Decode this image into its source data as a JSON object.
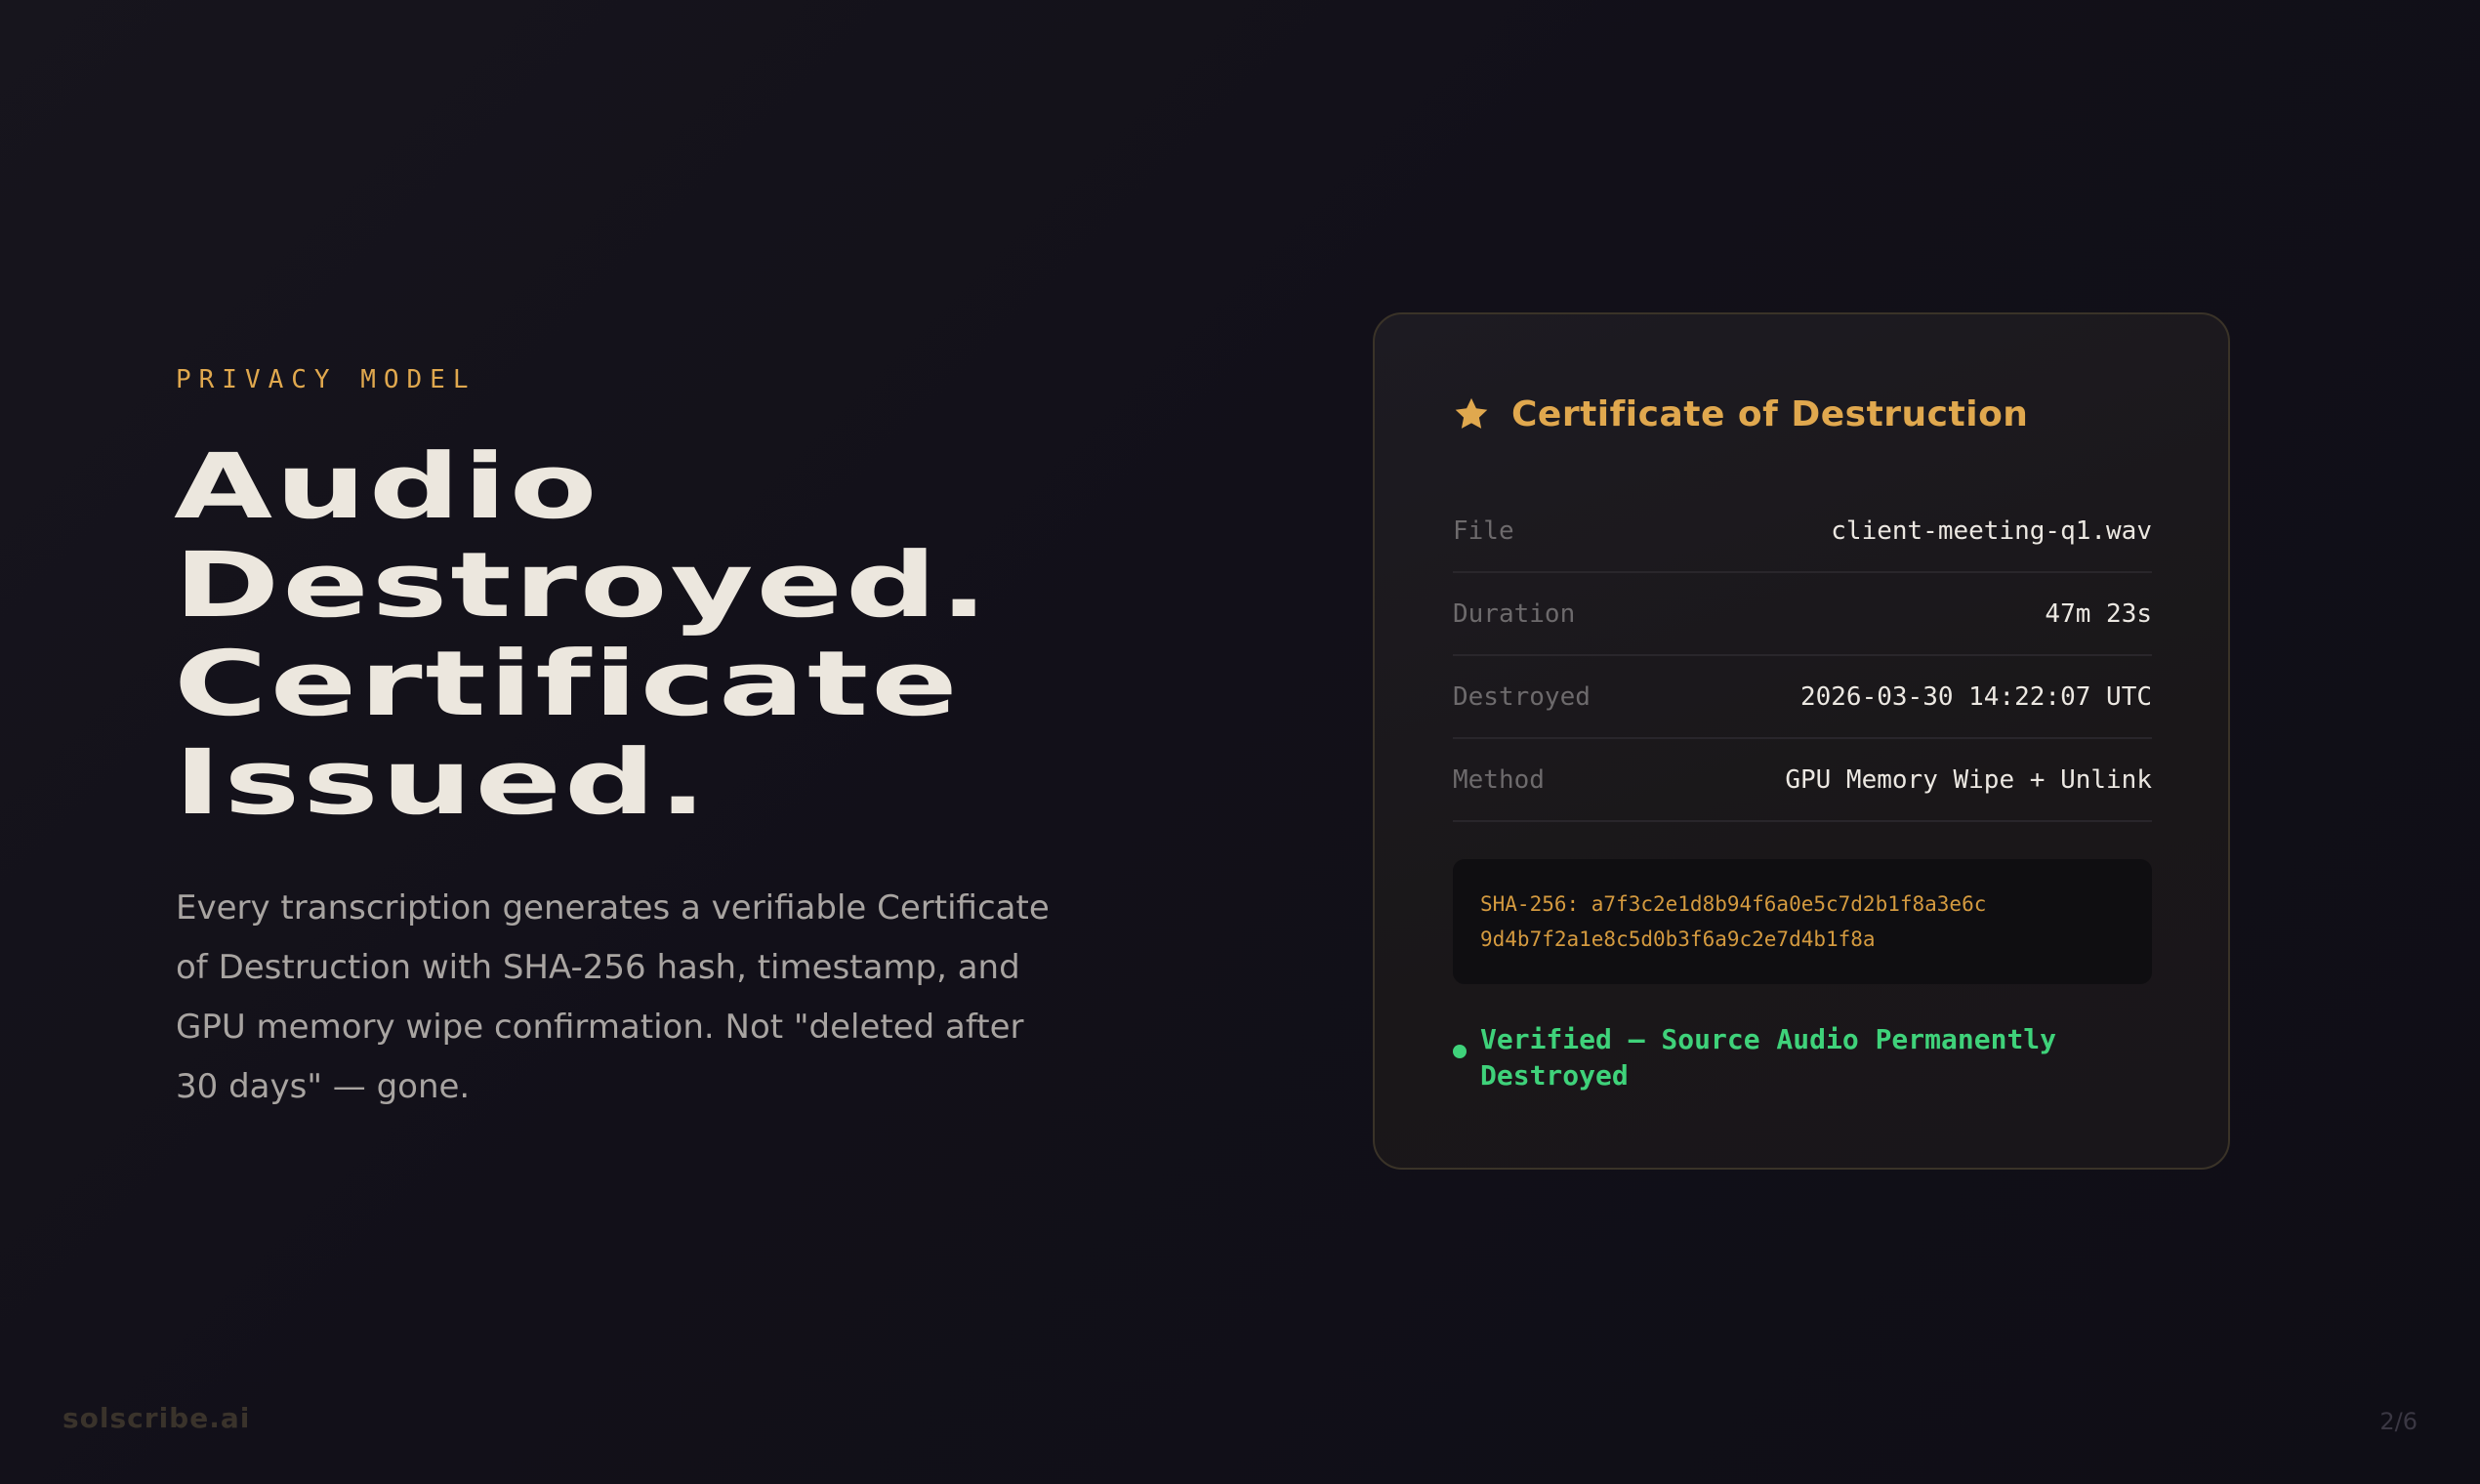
{
  "eyebrow": "PRIVACY MODEL",
  "headline": {
    "line1": "Audio",
    "line2": "Destroyed.",
    "line3": "Certificate",
    "line4": "Issued."
  },
  "body": "Every transcription generates a verifiable Certificate of Destruction with SHA-256 hash, timestamp, and GPU memory wipe confirmation. Not \"deleted after 30 days\" — gone.",
  "certificate": {
    "icon": "star-icon",
    "title": "Certificate of Destruction",
    "rows": [
      {
        "label": "File",
        "value": "client-meeting-q1.wav"
      },
      {
        "label": "Duration",
        "value": "47m 23s"
      },
      {
        "label": "Destroyed",
        "value": "2026-03-30 14:22:07 UTC"
      },
      {
        "label": "Method",
        "value": "GPU Memory Wipe + Unlink"
      }
    ],
    "hash_line1": "SHA-256: a7f3c2e1d8b94f6a0e5c7d2b1f8a3e6c",
    "hash_line2": "9d4b7f2a1e8c5d0b3f6a9c2e7d4b1f8a",
    "verified": "Verified — Source Audio Permanently Destroyed"
  },
  "footer": {
    "brand": "solscribe.ai",
    "page": "2/6"
  },
  "colors": {
    "accent": "#e0a84e",
    "success": "#3fd27a",
    "background": "#121019"
  }
}
